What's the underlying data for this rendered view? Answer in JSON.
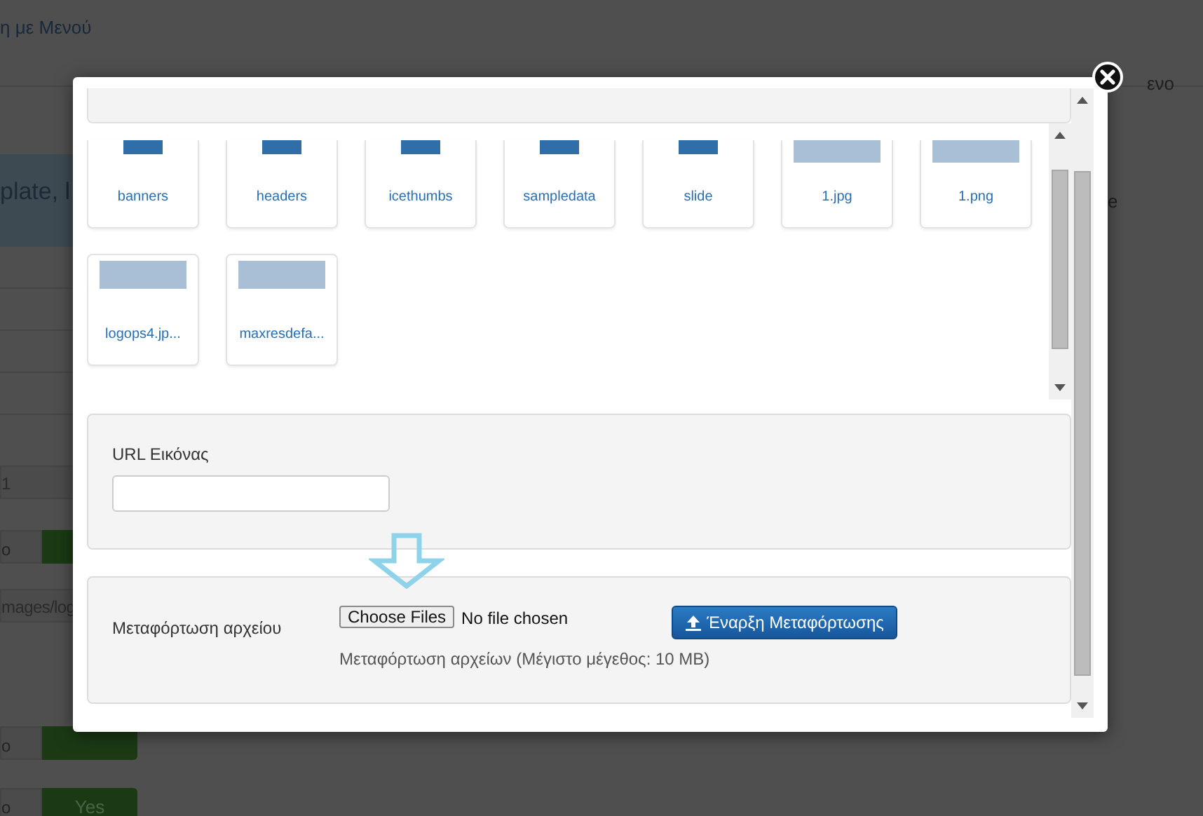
{
  "background": {
    "header_text": "η με Μενού",
    "banner_text": "plate, l",
    "right_texts": [
      "ενο",
      "e"
    ],
    "left_fields": [
      "1",
      "mages/log"
    ],
    "toggles": [
      {
        "off_label": "o"
      },
      {
        "off_label": "o"
      },
      {
        "off_label": "o",
        "on_label": "Yes"
      }
    ]
  },
  "modal": {
    "files": [
      {
        "name": "banners",
        "kind": "folder"
      },
      {
        "name": "headers",
        "kind": "folder"
      },
      {
        "name": "icethumbs",
        "kind": "folder"
      },
      {
        "name": "sampledata",
        "kind": "folder"
      },
      {
        "name": "slide",
        "kind": "folder"
      },
      {
        "name": "1.jpg",
        "kind": "image"
      },
      {
        "name": "1.png",
        "kind": "image"
      },
      {
        "name": "logops4.jp...",
        "kind": "image"
      },
      {
        "name": "maxresdefa...",
        "kind": "image"
      }
    ],
    "url_label": "URL Εικόνας",
    "upload": {
      "label": "Μεταφόρτωση αρχείου",
      "choose_button": "Choose Files",
      "file_status": "No file chosen",
      "start_button": "Έναρξη Μεταφόρτωσης",
      "help": "Μεταφόρτωση αρχείων (Μέγιστο μέγεθος: 10 MB)"
    }
  }
}
